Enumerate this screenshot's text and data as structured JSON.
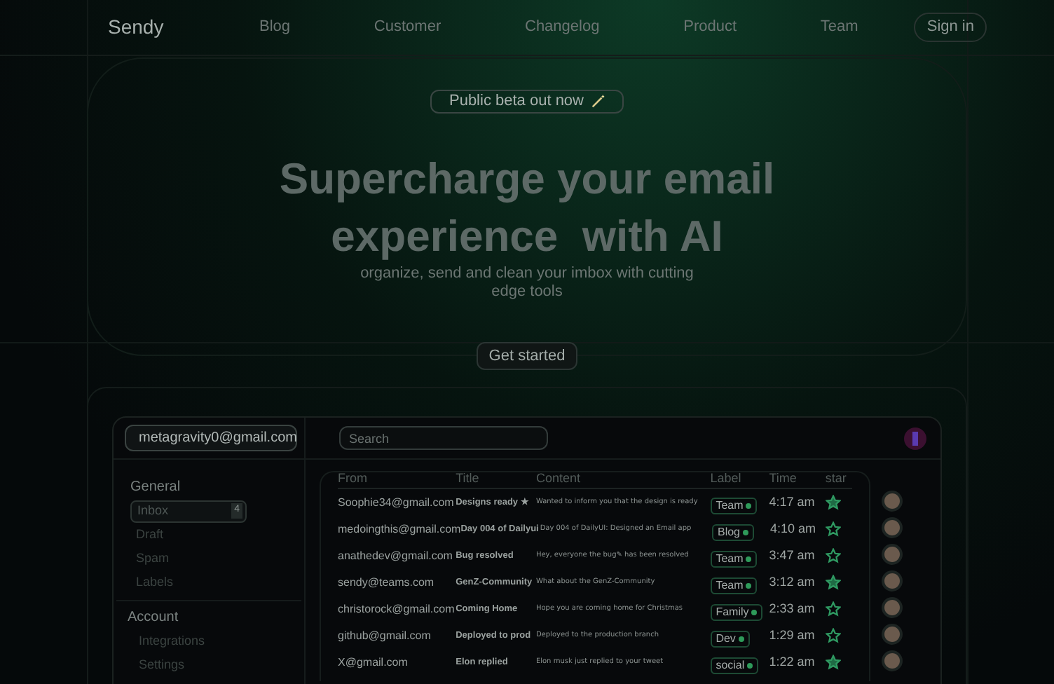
{
  "nav": {
    "logo": "Sendy",
    "links": [
      "Blog",
      "Customer",
      "Changelog",
      "Product",
      "Team"
    ],
    "signin": "Sign in"
  },
  "hero": {
    "badge": "Public beta out now",
    "title_lines": [
      "Supercharge your email",
      "experience  with AI"
    ],
    "subtitle": "organize, send and clean your imbox with cutting edge tools",
    "cta": "Get started"
  },
  "app": {
    "account": "metagravity0@gmail.com",
    "search": {
      "placeholder": "Search"
    },
    "sidebar": [
      {
        "heading": "General",
        "items": [
          {
            "label": "Inbox",
            "count": "4",
            "selected": true
          },
          {
            "label": "Draft",
            "selected": false
          },
          {
            "label": "Spam",
            "selected": false
          },
          {
            "label": "Labels",
            "selected": false
          }
        ]
      },
      {
        "heading": "Account",
        "items": [
          {
            "label": "Integrations",
            "selected": false
          },
          {
            "label": "Settings",
            "selected": false
          }
        ]
      }
    ],
    "columns": [
      "From",
      "Title",
      "Content",
      "Label",
      "Time",
      "star"
    ],
    "rows": [
      {
        "from": "Soophie34@gmail.com",
        "title": "Designs ready ★",
        "content": "Wanted to inform you that the design is ready",
        "label": "Team",
        "time": "4:17 am",
        "starred": true
      },
      {
        "from": "medoingthis@gmail.com",
        "title": "Day 004 of Dailyui",
        "content": "Day 004 of DailyUI: Designed an Email app",
        "label": "Blog",
        "time": "4:10 am",
        "starred": false
      },
      {
        "from": "anathedev@gmail.com",
        "title": "Bug resolved",
        "content": "Hey,  everyone the bug✎ has been resolved",
        "label": "Team",
        "time": "3:47 am",
        "starred": false
      },
      {
        "from": "sendy@teams.com",
        "title": "GenZ-Community",
        "content": "What about the GenZ-Community",
        "label": "Team",
        "time": "3:12 am",
        "starred": true
      },
      {
        "from": "christorock@gmail.com",
        "title": "Coming Home",
        "content": "Hope you are coming home for Christmas",
        "label": "Family",
        "time": "2:33 am",
        "starred": false
      },
      {
        "from": "github@gmail.com",
        "title": "Deployed to prod",
        "content": "Deployed to the production branch",
        "label": "Dev",
        "time": "1:29 am",
        "starred": false
      },
      {
        "from": "X@gmail.com",
        "title": "Elon replied",
        "content": "Elon musk just replied to your tweet",
        "label": "social",
        "time": "1:22 am",
        "starred": true
      }
    ]
  }
}
